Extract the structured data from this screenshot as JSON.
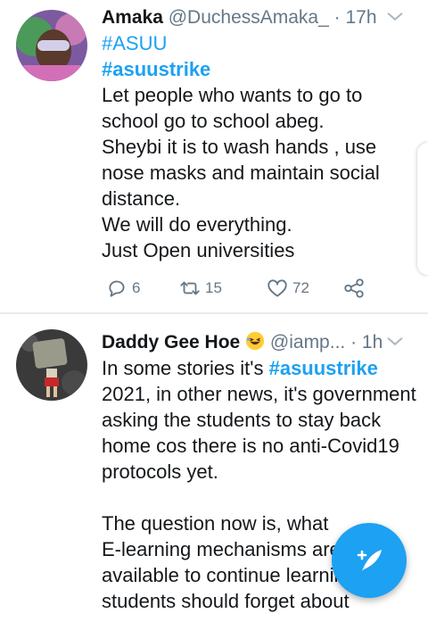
{
  "tweets": [
    {
      "name": "Amaka",
      "handle": "@DuchessAmaka_",
      "separator": " · ",
      "time": "17h",
      "lines": [
        "#ASUU",
        "#asuustrike",
        "Let people who wants to go to",
        "school go to school abeg.",
        "Sheybi it is to wash hands , use",
        "nose masks and maintain social",
        "distance.",
        "We will do everything.",
        "Just Open universities"
      ],
      "replies": "6",
      "retweets": "15",
      "likes": "72"
    },
    {
      "name": "Daddy Gee Hoe",
      "handle": "@iamp...",
      "separator": " · ",
      "time": "1h",
      "line1_prefix": "In some stories it's ",
      "line1_tag": "#asuustrike",
      "lines": [
        "2021, in other news, it's government",
        "asking the students to stay back",
        "home cos there is no anti-Covid19",
        "protocols yet.",
        "",
        "The question now is, what",
        "E-learning mechanisms are",
        "available to continue learnin",
        "students should forget about"
      ]
    }
  ],
  "icons": {
    "reply": "reply-icon",
    "retweet": "retweet-icon",
    "like": "heart-icon",
    "share": "share-icon",
    "chevron": "chevron-down-icon",
    "compose": "compose-tweet-icon",
    "emoji": "rolling-laughing-emoji"
  },
  "colors": {
    "accent": "#1da1f2",
    "secondary_text": "#657786",
    "divider": "#e6ecf0"
  }
}
